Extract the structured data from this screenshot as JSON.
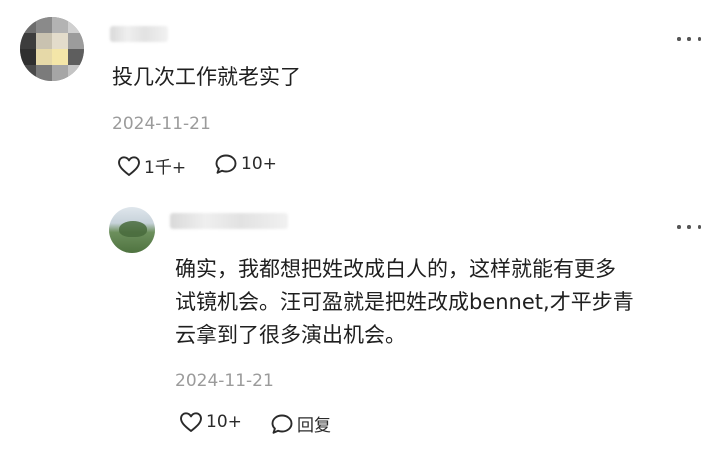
{
  "main_comment": {
    "text": "投几次工作就老实了",
    "date": "2024-11-21",
    "like_count": "1千+",
    "comment_count": "10+"
  },
  "reply": {
    "text_line1": "确实，我都想把姓改成白人的，这样就能有更多",
    "text_line2": "试镜机会。汪可盈就是把姓改成bennet,才平步青",
    "text_line3": "云拿到了很多演出机会。",
    "date": "2024-11-21",
    "like_count": "10+",
    "reply_label": "回复"
  },
  "icons": {
    "like": "heart-outline-icon",
    "comment": "speech-bubble-icon",
    "more": "ellipsis-icon"
  },
  "colors": {
    "text": "#1f1f1f",
    "meta": "#9b9b9b",
    "icon": "#2a2a2a"
  }
}
